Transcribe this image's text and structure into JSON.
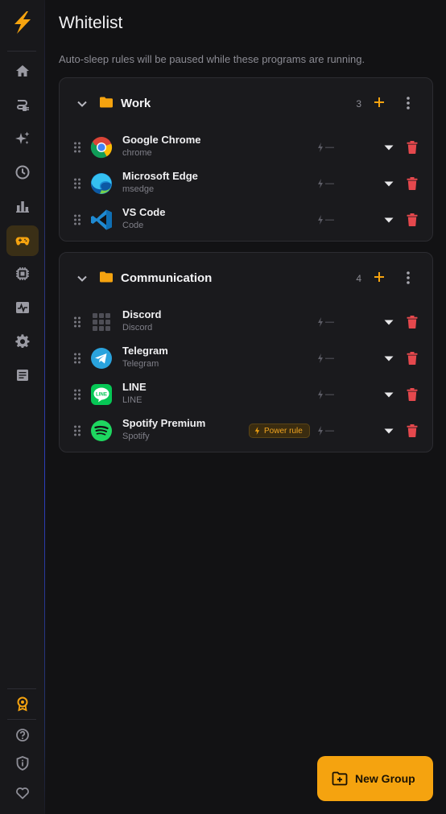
{
  "colors": {
    "accent": "#f5a30f",
    "danger": "#e5484d",
    "background": "#121214",
    "card": "#1a1a1d"
  },
  "sidebar": {
    "logo": "lightning-logo",
    "items": [
      {
        "icon": "home-icon",
        "active": false
      },
      {
        "icon": "plug-icon",
        "active": false
      },
      {
        "icon": "sparkles-icon",
        "active": false
      },
      {
        "icon": "clock-icon",
        "active": false
      },
      {
        "icon": "bar-chart-icon",
        "active": false
      },
      {
        "icon": "gamepad-icon",
        "active": true
      },
      {
        "icon": "cpu-icon",
        "active": false
      },
      {
        "icon": "activity-monitor-icon",
        "active": false
      },
      {
        "icon": "gear-icon",
        "active": false
      },
      {
        "icon": "document-icon",
        "active": false
      }
    ],
    "bottom_items": [
      {
        "icon": "badge-award-icon"
      },
      {
        "icon": "help-icon"
      },
      {
        "icon": "info-shield-icon"
      },
      {
        "icon": "heart-icon"
      }
    ]
  },
  "page": {
    "title": "Whitelist",
    "subtitle": "Auto-sleep rules will be paused while these programs are running."
  },
  "groups": [
    {
      "name": "Work",
      "count": "3",
      "apps": [
        {
          "name": "Google Chrome",
          "process": "chrome",
          "icon": "chrome-icon",
          "power": "—"
        },
        {
          "name": "Microsoft Edge",
          "process": "msedge",
          "icon": "edge-icon",
          "power": "—"
        },
        {
          "name": "VS Code",
          "process": "Code",
          "icon": "vscode-icon",
          "power": "—"
        }
      ]
    },
    {
      "name": "Communication",
      "count": "4",
      "apps": [
        {
          "name": "Discord",
          "process": "Discord",
          "icon": "discord-placeholder-icon",
          "power": "—"
        },
        {
          "name": "Telegram",
          "process": "Telegram",
          "icon": "telegram-icon",
          "power": "—"
        },
        {
          "name": "LINE",
          "process": "LINE",
          "icon": "line-icon",
          "power": "—"
        },
        {
          "name": "Spotify Premium",
          "process": "Spotify",
          "icon": "spotify-icon",
          "power": "—",
          "badge": "Power rule"
        }
      ]
    }
  ],
  "new_group_label": "New Group"
}
